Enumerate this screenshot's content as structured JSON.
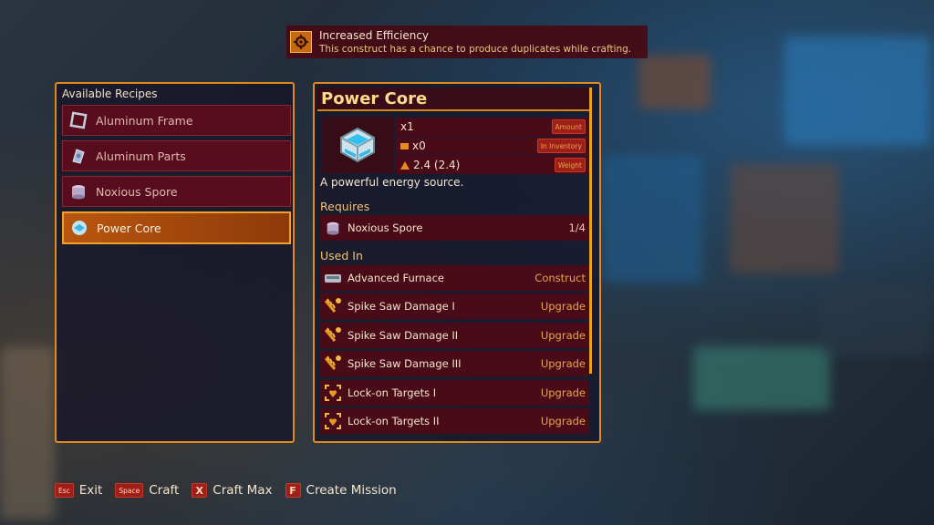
{
  "tooltip": {
    "title": "Increased Efficiency",
    "description": "This construct has a chance to produce duplicates while crafting.",
    "icon": "gear-icon"
  },
  "recipes_panel": {
    "title": "Available Recipes",
    "items": [
      {
        "label": "Aluminum Frame",
        "icon": "frame-icon"
      },
      {
        "label": "Aluminum Parts",
        "icon": "parts-icon"
      },
      {
        "label": "Noxious Spore",
        "icon": "spore-icon"
      },
      {
        "label": "Power Core",
        "icon": "power-core-icon",
        "selected": true
      }
    ]
  },
  "detail": {
    "title": "Power Core",
    "stats": [
      {
        "value": "x1",
        "key": "Amount"
      },
      {
        "value": "x0",
        "key": "In Inventory"
      },
      {
        "value": "2.4 (2.4)",
        "key": "Weight"
      }
    ],
    "description": "A powerful energy source.",
    "requires_label": "Requires",
    "requires": [
      {
        "name": "Noxious Spore",
        "count": "1/4"
      }
    ],
    "used_in_label": "Used In",
    "used_in": [
      {
        "name": "Advanced Furnace",
        "type": "Construct",
        "icon": "furnace-icon"
      },
      {
        "name": "Spike Saw Damage I",
        "type": "Upgrade",
        "icon": "saw-upgrade-icon"
      },
      {
        "name": "Spike Saw Damage II",
        "type": "Upgrade",
        "icon": "saw-upgrade-icon"
      },
      {
        "name": "Spike Saw Damage III",
        "type": "Upgrade",
        "icon": "saw-upgrade-icon"
      },
      {
        "name": "Lock-on Targets I",
        "type": "Upgrade",
        "icon": "target-upgrade-icon"
      },
      {
        "name": "Lock-on Targets II",
        "type": "Upgrade",
        "icon": "target-upgrade-icon"
      }
    ]
  },
  "hints": [
    {
      "key": "Esc",
      "label": "Exit"
    },
    {
      "key": "Space",
      "label": "Craft"
    },
    {
      "key": "X",
      "label": "Craft Max"
    },
    {
      "key": "F",
      "label": "Create Mission"
    }
  ],
  "colors": {
    "accent": "#e08a1e",
    "row_bg": "#5c0c1c",
    "selected": "#b8560e",
    "label_orange": "#e9a44a"
  }
}
